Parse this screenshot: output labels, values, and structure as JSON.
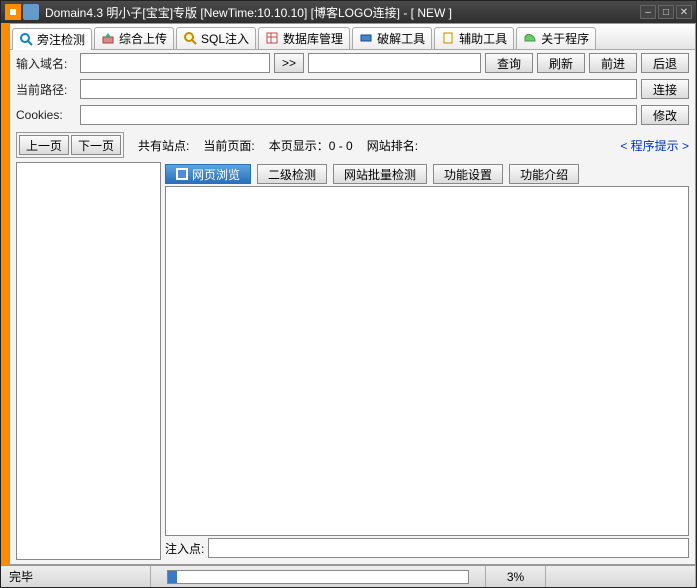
{
  "window": {
    "title": "Domain4.3 明小子[宝宝]专版 [NewTime:10.10.10] [博客LOGO连接]  - [ NEW ]"
  },
  "tabs": {
    "t0": "旁注检测",
    "t1": "综合上传",
    "t2": "SQL注入",
    "t3": "数据库管理",
    "t4": "破解工具",
    "t5": "辅助工具",
    "t6": "关于程序"
  },
  "labels": {
    "input_domain": "输入域名:",
    "current_path": "当前路径:",
    "cookies": "Cookies:",
    "total_sites": "共有站点:",
    "current_page": "当前页面:",
    "page_display": "本页显示：0 - 0",
    "site_rank": "网站排名:",
    "inject_point": "注入点:"
  },
  "buttons": {
    "go": ">>",
    "query": "查询",
    "refresh": "刷新",
    "forward": "前进",
    "back": "后退",
    "connect": "连接",
    "modify": "修改",
    "prev": "上一页",
    "next": "下一页",
    "hint": "< 程序提示 >"
  },
  "subtabs": {
    "s0": "网页浏览",
    "s1": "二级检测",
    "s2": "网站批量检测",
    "s3": "功能设置",
    "s4": "功能介绍"
  },
  "status": {
    "text": "完毕",
    "percent": "3%"
  },
  "fields": {
    "domain": "",
    "url": "",
    "path": "",
    "cookies": "",
    "inject": ""
  }
}
